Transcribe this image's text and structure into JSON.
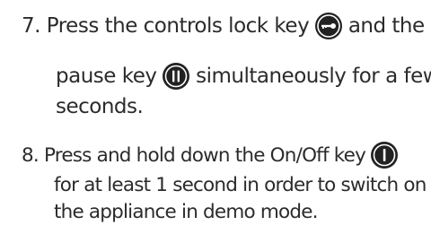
{
  "steps": [
    {
      "number": "7.",
      "line1_a": "Press the controls lock key",
      "line1_b": "and the",
      "line2_a": "pause key",
      "line2_b": "simultaneously for a few",
      "line3": "seconds."
    },
    {
      "number": "8.",
      "line1_a": "Press and hold down the On/Off key",
      "line2": "for at least 1 second in order to switch on",
      "line3": "the appliance in demo mode."
    }
  ],
  "icons": [
    "controls-lock-key-icon",
    "pause-key-icon",
    "on-off-key-icon"
  ],
  "colors": {
    "text": "#2b2b2b",
    "icon_bg": "#222222"
  }
}
